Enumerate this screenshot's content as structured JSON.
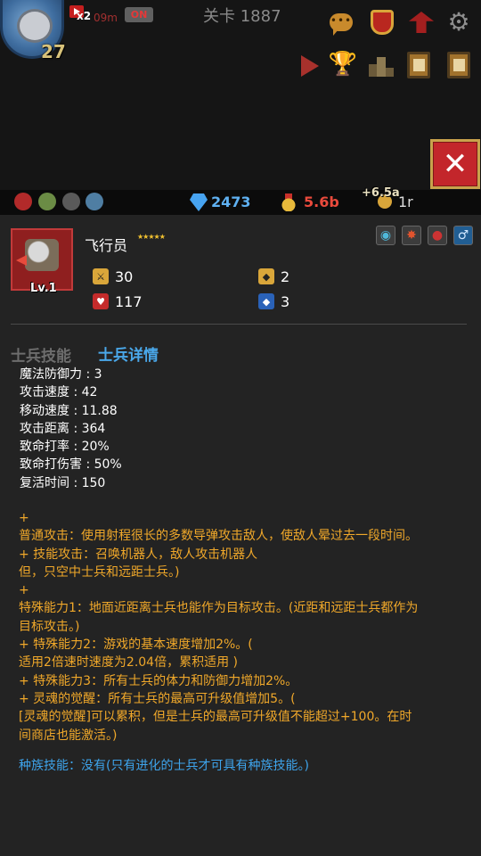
{
  "colors": {
    "background": "#232323",
    "accent_blue": "#4aa8ea",
    "skill_orange": "#f0a82a",
    "gem_blue": "#5fb1f2",
    "gold_red": "#ea4a3c",
    "close_red": "#c3262b"
  },
  "header": {
    "player_level": "27",
    "boost_multiplier": "x2",
    "boost_time": "09m",
    "boost_toggle": "ON",
    "stage_title": "关卡 1887",
    "icons": [
      "chat-icon",
      "battle-icon",
      "guild-icon",
      "settings-icon",
      "play-icon",
      "trophy-icon",
      "ranking-icon",
      "quest-book-icon",
      "codex-book-icon"
    ],
    "close_label": "✕"
  },
  "resources": {
    "gems": "2473",
    "gold": "5.6b",
    "floating_bonus": "+6.5a",
    "third_resource": "1r"
  },
  "soldier": {
    "name": "飞行员",
    "stars": "★★★★★",
    "level": "Lv.1",
    "attack": "30",
    "hp": "117",
    "defense": "2",
    "magic_defense": "3",
    "action_icons": [
      "view-icon",
      "skill-fire-icon",
      "character-icon",
      "gender-male-icon"
    ]
  },
  "tabs": {
    "skills": "士兵技能",
    "details": "士兵详情"
  },
  "attributes": [
    "魔法防御力 : 3",
    "攻击速度 : 42",
    "移动速度 : 11.88",
    "攻击距离 : 364",
    "致命打率 : 20%",
    "致命打伤害 : 50%",
    "复活时间 : 150"
  ],
  "skill_lines": [
    "",
    "+",
    "普通攻击：使用射程很长的多数导弹攻击敌人，使敌人晕过去一段时间。",
    "+ 技能攻击：召唤机器人，敌人攻击机器人",
    "但，只空中士兵和远距士兵。)",
    "+",
    "特殊能力1：地面近距离士兵也能作为目标攻击。(近距和远距士兵都作为",
    "目标攻击。)",
    "+ 特殊能力2：游戏的基本速度增加2%。(",
    "适用2倍速时速度为2.04倍，累积适用 )",
    "+ 特殊能力3：所有士兵的体力和防御力增加2%。",
    "+ 灵魂的觉醒：所有士兵的最高可升级值增加5。(",
    "[灵魂的觉醒]可以累积，但是士兵的最高可升级值不能超过+100。在时",
    "间商店也能激活。)"
  ],
  "race_skill": "种族技能：没有(只有进化的士兵才可具有种族技能。)"
}
